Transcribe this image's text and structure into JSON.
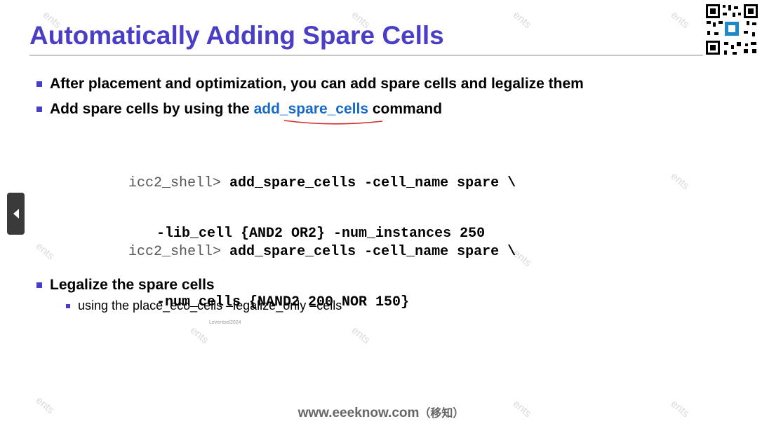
{
  "slide": {
    "title": "Automatically Adding Spare Cells",
    "bullets": [
      "After placement and optimization, you can add spare cells and legalize them",
      {
        "before": "Add spare cells by using the ",
        "command": "add_spare_cells",
        "after": " command"
      },
      "Legalize the spare cells"
    ],
    "sub_bullet": "using the place_eco_cells –legalize_only –cells",
    "code_block_1": {
      "prompt": "icc2_shell>",
      "line1": "add_spare_cells -cell_name spare \\",
      "line2": "-lib_cell {AND2 OR2} -num_instances 250"
    },
    "code_block_2": {
      "prompt": "icc2_shell>",
      "line1": "add_spare_cells -cell_name spare \\",
      "line2": "-num_cells {NAND2 200 NOR 150}"
    },
    "footer": {
      "site": "www.eeeknow.com",
      "cn": "（移知）"
    },
    "small_label": "Leventsel2024"
  },
  "colors": {
    "title": "#4a3ec6",
    "command_link": "#1769c8",
    "underline": "#d42a2a"
  },
  "icons": {
    "nav": "chevron-left-icon",
    "qr": "qr-code-icon"
  }
}
